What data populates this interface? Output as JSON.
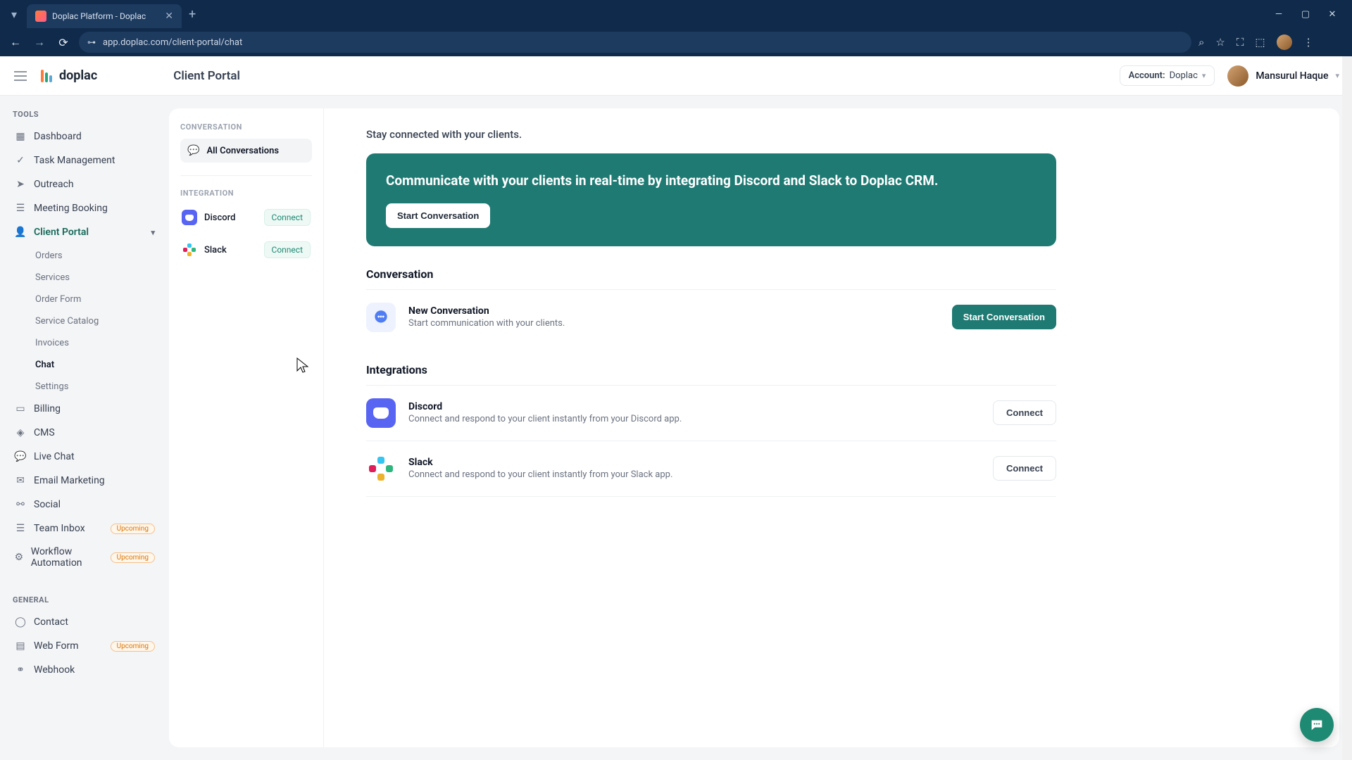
{
  "browser": {
    "tab_title": "Doplac Platform - Doplac",
    "url": "app.doplac.com/client-portal/chat"
  },
  "header": {
    "brand": "doplac",
    "page_title": "Client Portal",
    "account_label": "Account:",
    "account_value": "Doplac",
    "user_name": "Mansurul Haque"
  },
  "sidebar": {
    "tools_label": "TOOLS",
    "general_label": "GENERAL",
    "items": {
      "dashboard": "Dashboard",
      "task_management": "Task Management",
      "outreach": "Outreach",
      "meeting_booking": "Meeting Booking",
      "client_portal": "Client Portal",
      "billing": "Billing",
      "cms": "CMS",
      "live_chat": "Live Chat",
      "email_marketing": "Email Marketing",
      "social": "Social",
      "team_inbox": "Team Inbox",
      "workflow_automation": "Workflow Automation",
      "contact": "Contact",
      "web_form": "Web Form",
      "webhook": "Webhook"
    },
    "client_portal_sub": {
      "orders": "Orders",
      "services": "Services",
      "order_form": "Order Form",
      "service_catalog": "Service Catalog",
      "invoices": "Invoices",
      "chat": "Chat",
      "settings": "Settings"
    },
    "upcoming_badge": "Upcoming"
  },
  "sub_sidebar": {
    "conversation_label": "CONVERSATION",
    "all_conversations": "All Conversations",
    "integration_label": "INTEGRATION",
    "discord": "Discord",
    "slack": "Slack",
    "connect": "Connect"
  },
  "main": {
    "lead": "Stay connected with your clients.",
    "hero_title": "Communicate with your clients in real-time by integrating Discord and Slack to Doplac CRM.",
    "hero_cta": "Start Conversation",
    "conversation_heading": "Conversation",
    "new_conv_title": "New Conversation",
    "new_conv_sub": "Start communication with your clients.",
    "start_conversation_btn": "Start Conversation",
    "integrations_heading": "Integrations",
    "discord_title": "Discord",
    "discord_sub": "Connect and respond to your client instantly from your Discord app.",
    "slack_title": "Slack",
    "slack_sub": "Connect and respond to your client instantly from your Slack app.",
    "connect_btn": "Connect"
  }
}
